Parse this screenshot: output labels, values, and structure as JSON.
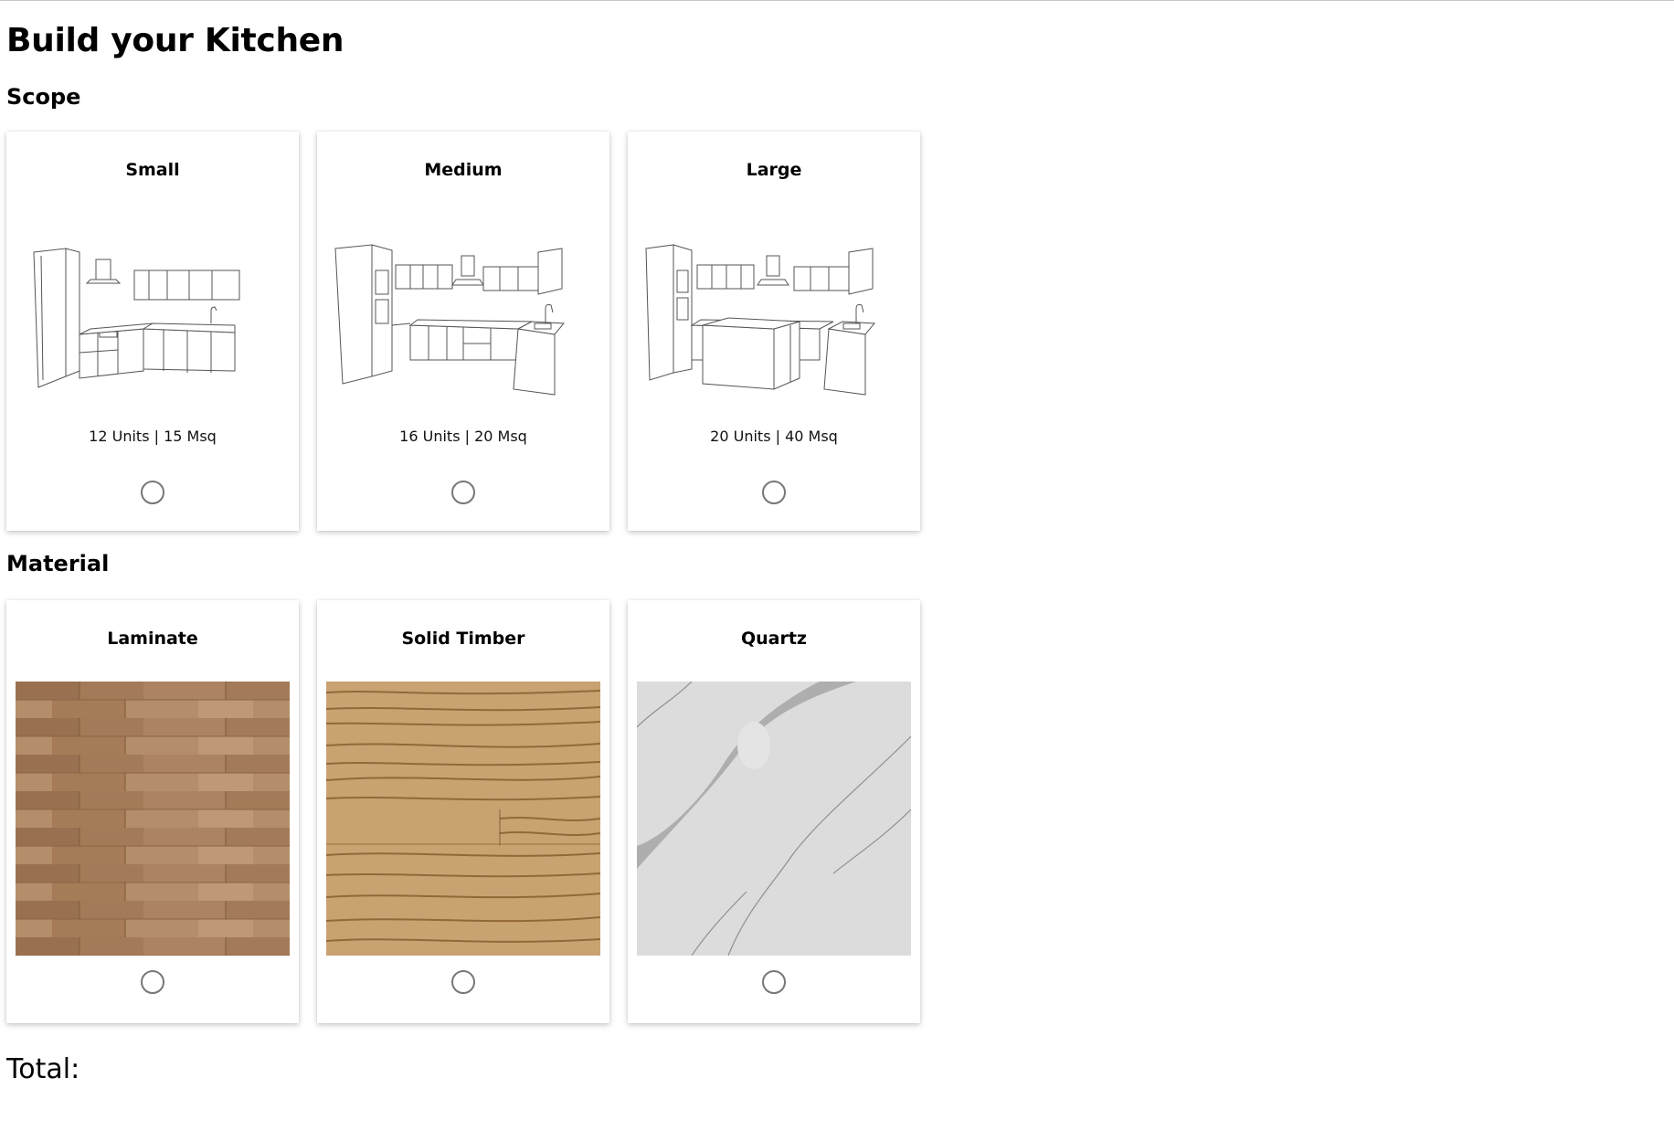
{
  "page": {
    "title": "Build your Kitchen",
    "total_label": "Total:"
  },
  "scope": {
    "heading": "Scope",
    "options": [
      {
        "label": "Small",
        "meta": "12 Units | 15 Msq",
        "icon": "small-kitchen-illustration"
      },
      {
        "label": "Medium",
        "meta": "16 Units | 20 Msq",
        "icon": "medium-kitchen-illustration"
      },
      {
        "label": "Large",
        "meta": "20 Units | 40 Msq",
        "icon": "large-kitchen-illustration"
      }
    ]
  },
  "material": {
    "heading": "Material",
    "options": [
      {
        "label": "Laminate",
        "swatch": "laminate-texture",
        "color": "#a67e5c"
      },
      {
        "label": "Solid Timber",
        "swatch": "solid-timber-texture",
        "color": "#c8a06e"
      },
      {
        "label": "Quartz",
        "swatch": "quartz-texture",
        "color": "#dcdcdc"
      }
    ]
  }
}
